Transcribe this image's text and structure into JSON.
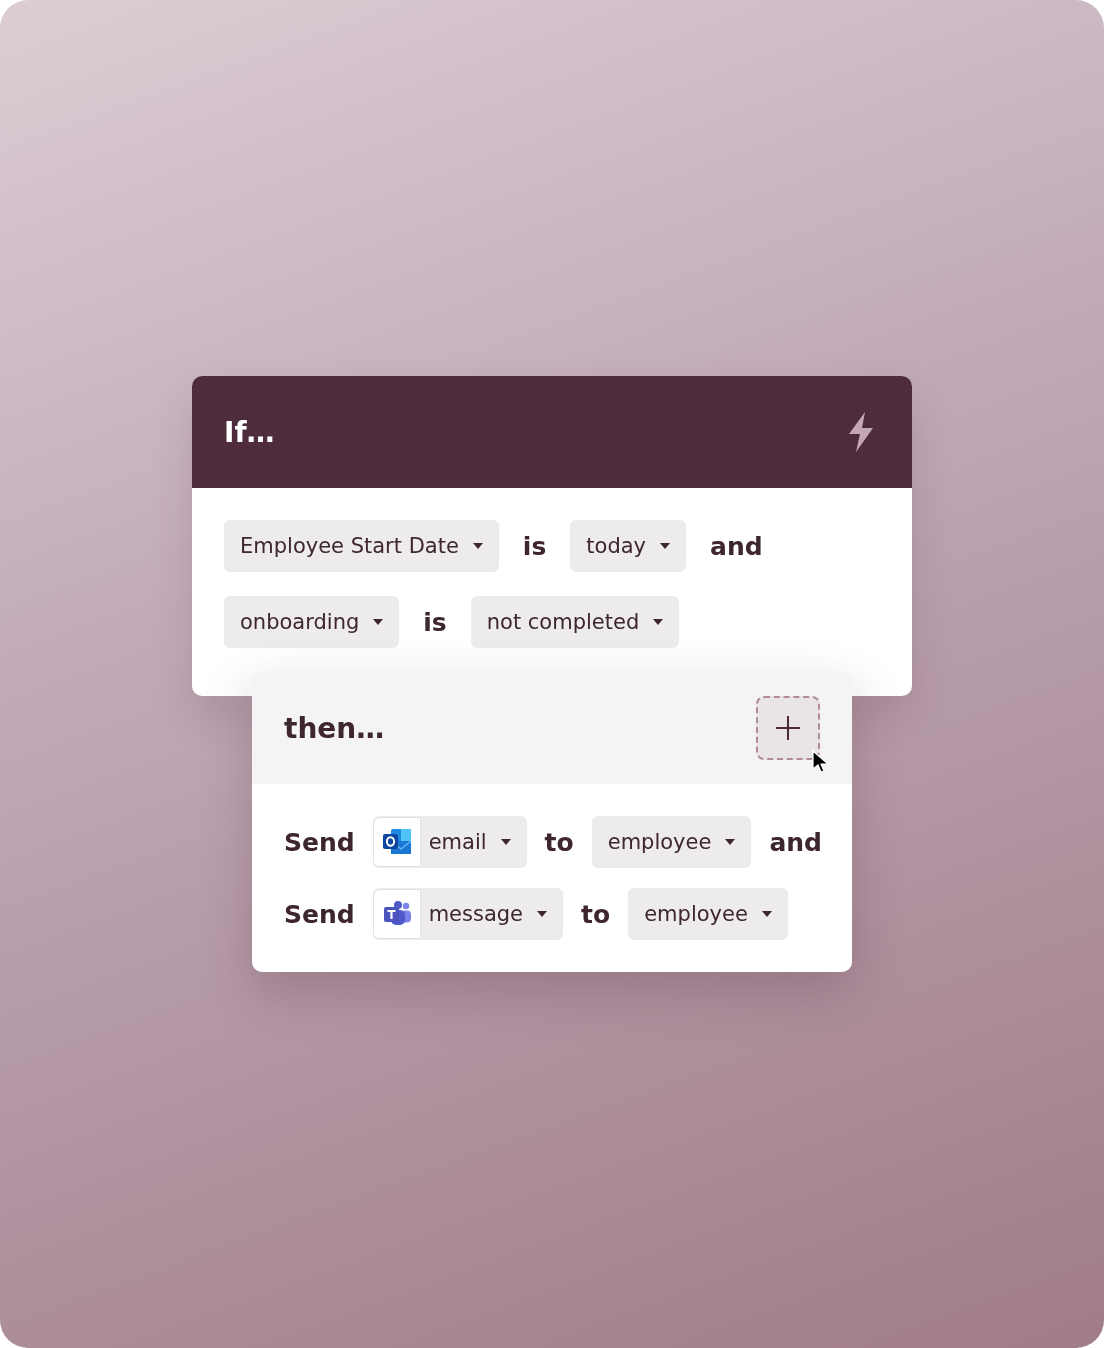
{
  "if_card": {
    "title": "If…",
    "conditions": [
      {
        "field": "Employee Start Date",
        "operator": "is",
        "value": "today",
        "joiner": "and"
      },
      {
        "field": "onboarding",
        "operator": "is",
        "value": "not completed"
      }
    ]
  },
  "then_card": {
    "title": "then…",
    "actions": [
      {
        "verb": "Send",
        "channel": {
          "kind": "mail",
          "label": "email"
        },
        "preposition": "to",
        "recipient": "employee",
        "joiner": "and"
      },
      {
        "verb": "Send",
        "channel": {
          "kind": "chat",
          "label": "message"
        },
        "preposition": "to",
        "recipient": "employee"
      }
    ]
  }
}
